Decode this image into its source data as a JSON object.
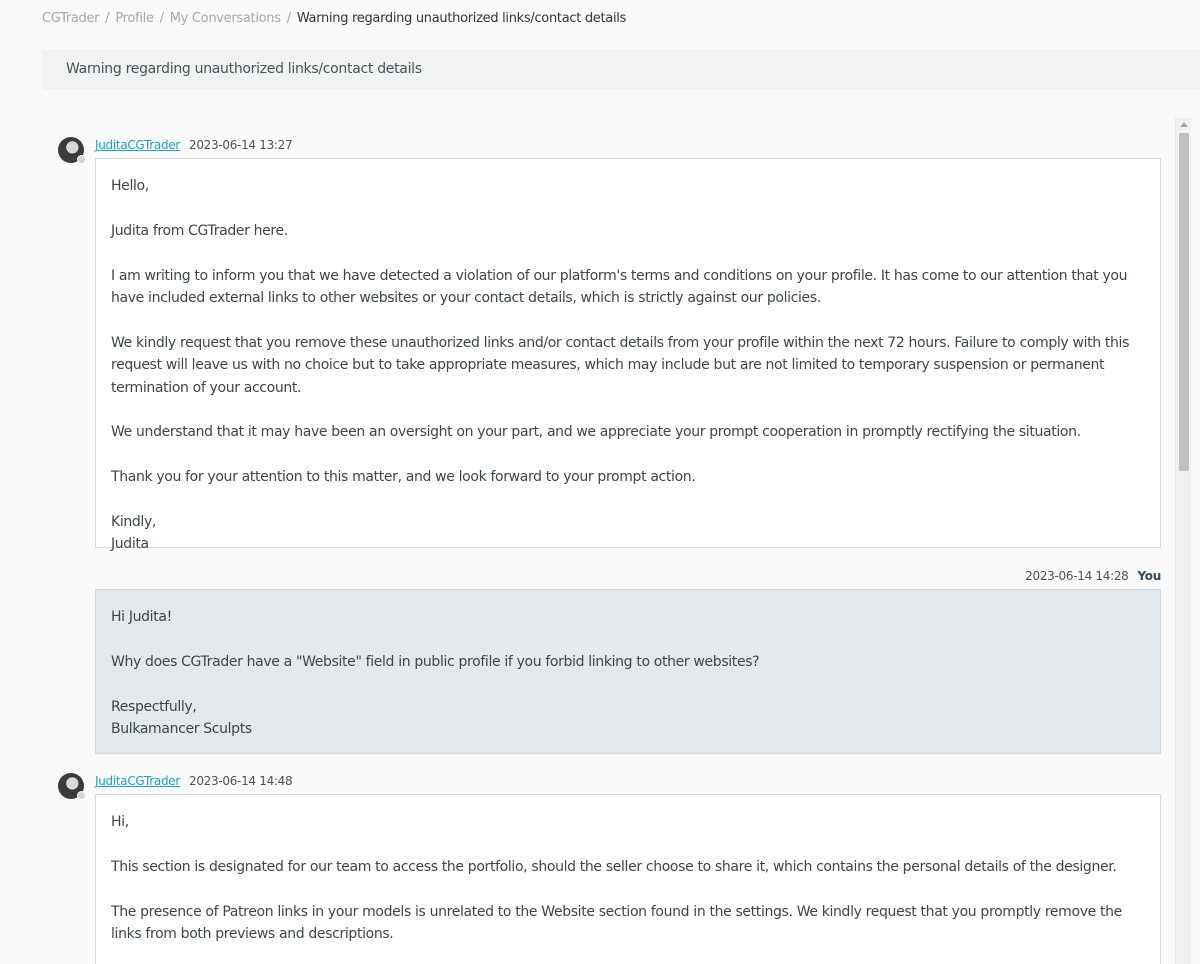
{
  "breadcrumb": {
    "items": [
      "CGTrader",
      "Profile",
      "My Conversations"
    ],
    "separator": "/",
    "current": "Warning regarding unauthorized links/contact details"
  },
  "subject": "Warning regarding unauthorized links/contact details",
  "messages": [
    {
      "author": "JuditaCGTrader",
      "time": "2023-06-14 13:27",
      "paragraphs": [
        "Hello,",
        "Judita from CGTrader here.",
        "I am writing to inform you that we have detected a violation of our platform's terms and conditions on your profile. It has come to our attention that you have included external links to other websites or your contact details, which is strictly against our policies.",
        "We kindly request that you remove these unauthorized links and/or contact details from your profile within the next 72 hours. Failure to comply with this request will leave us with no choice but to take appropriate measures, which may include but are not limited to temporary suspension or permanent termination of your account.",
        "We understand that it may have been an oversight on your part, and we appreciate your prompt cooperation in promptly rectifying the situation.",
        "Thank you for your attention to this matter, and we look forward to your prompt action."
      ],
      "signoff": [
        "Kindly,",
        "Judita"
      ]
    },
    {
      "author": "You",
      "time": "2023-06-14 14:28",
      "paragraphs": [
        "Hi Judita!",
        "Why does CGTrader have a \"Website\" field in public profile if you forbid linking to other websites?"
      ],
      "signoff": [
        "Respectfully,",
        "Bulkamancer Sculpts"
      ]
    },
    {
      "author": "JuditaCGTrader",
      "time": "2023-06-14 14:48",
      "paragraphs": [
        "Hi,",
        "This section is designated for our team to access the portfolio, should the seller choose to share it, which contains the personal details of the designer.",
        "The presence of Patreon links in your models is unrelated to the Website section found in the settings. We kindly request that you promptly remove the links from both previews and descriptions."
      ]
    }
  ]
}
